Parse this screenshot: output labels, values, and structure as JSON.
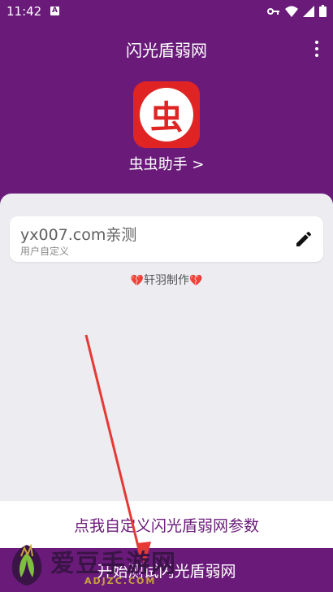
{
  "status_bar": {
    "time": "11:42",
    "notification_badge": "A",
    "icons": [
      "key-icon",
      "wifi-icon",
      "signal-icon",
      "battery-icon"
    ]
  },
  "app_bar": {
    "title": "闪光盾弱网"
  },
  "header": {
    "logo_glyph": "虫",
    "helper_link": "虫虫助手 >"
  },
  "card": {
    "value": "yx007.com亲测",
    "hint": "用户自定义"
  },
  "credit": {
    "heart_left": "💔",
    "text": "轩羽制作",
    "heart_right": "💔"
  },
  "buttons": {
    "custom": "点我自定义闪光盾弱网参数",
    "start": "开始测试闪光盾弱网"
  },
  "watermark": {
    "text": "爱豆手游网",
    "sub": "ADJZC.COM"
  },
  "colors": {
    "primary": "#6a1b7a",
    "sheet": "#ececf1",
    "logo_red": "#e02424",
    "arrow_red": "#e53935"
  }
}
